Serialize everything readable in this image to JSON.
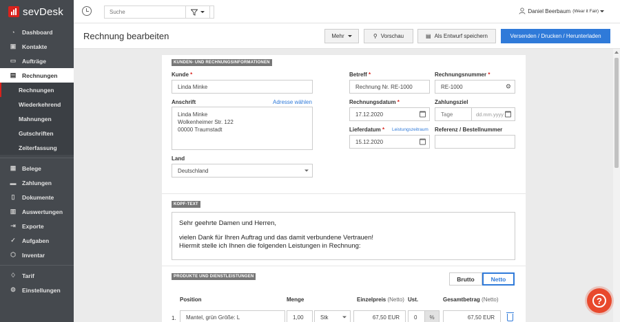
{
  "app": {
    "logo_text": "sevDesk"
  },
  "topbar": {
    "search_placeholder": "Suche",
    "user_name": "Daniel Beerbaum",
    "user_company": "(Wear it Fair)"
  },
  "sidebar": {
    "items": [
      {
        "label": "Dashboard",
        "icon": "speedometer-icon"
      },
      {
        "label": "Kontakte",
        "icon": "contacts-icon"
      },
      {
        "label": "Aufträge",
        "icon": "folder-icon"
      },
      {
        "label": "Rechnungen",
        "icon": "document-icon"
      }
    ],
    "sub_items": [
      {
        "label": "Rechnungen"
      },
      {
        "label": "Wiederkehrend"
      },
      {
        "label": "Mahnungen"
      },
      {
        "label": "Gutschriften"
      },
      {
        "label": "Zeiterfassung"
      }
    ],
    "items2": [
      {
        "label": "Belege",
        "icon": "receipt-icon"
      },
      {
        "label": "Zahlungen",
        "icon": "card-icon"
      },
      {
        "label": "Dokumente",
        "icon": "files-icon"
      },
      {
        "label": "Auswertungen",
        "icon": "chart-icon"
      },
      {
        "label": "Exporte",
        "icon": "export-icon"
      },
      {
        "label": "Aufgaben",
        "icon": "check-icon"
      },
      {
        "label": "Inventar",
        "icon": "box-icon"
      }
    ],
    "items3": [
      {
        "label": "Tarif",
        "icon": "bell-icon"
      },
      {
        "label": "Einstellungen",
        "icon": "gear-icon"
      }
    ]
  },
  "header": {
    "title": "Rechnung bearbeiten",
    "mehr": "Mehr",
    "vorschau": "Vorschau",
    "entwurf": "Als Entwurf speichern",
    "send": "Versenden / Drucken / Herunterladen"
  },
  "customer_section": {
    "tag": "KUNDEN- UND RECHNUNGSINFORMATIONEN",
    "kunde_label": "Kunde",
    "kunde_value": "Linda Minke",
    "anschrift_label": "Anschrift",
    "adresse_link": "Adresse wählen",
    "address_lines": [
      "Linda Minke",
      "Wolkenheimer Str. 122",
      "00000 Traumstadt"
    ],
    "land_label": "Land",
    "land_value": "Deutschland",
    "betreff_label": "Betreff",
    "betreff_value": "Rechnung Nr. RE-1000",
    "nummer_label": "Rechnungsnummer",
    "nummer_value": "RE-1000",
    "datum_label": "Rechnungsdatum",
    "datum_value": "17.12.2020",
    "ziel_label": "Zahlungsziel",
    "ziel_placeholder": "Tage",
    "ziel_date_placeholder": "dd.mm.yyyy",
    "liefer_label": "Lieferdatum",
    "leistung_link": "Leistungszeitraum",
    "liefer_value": "15.12.2020",
    "referenz_label": "Referenz / Bestellnummer",
    "referenz_value": ""
  },
  "kopf_section": {
    "tag": "KOPF-TEXT",
    "line1": "Sehr geehrte Damen und Herren,",
    "line2": "vielen Dank für Ihren Auftrag und das damit verbundene Vertrauen!",
    "line3": "Hiermit stelle ich Ihnen die folgenden Leistungen in Rechnung:"
  },
  "products_section": {
    "tag": "PRODUKTE UND DIENSTLEISTUNGEN",
    "brutto": "Brutto",
    "netto": "Netto",
    "col_position": "Position",
    "col_menge": "Menge",
    "col_einzelpreis": "Einzelpreis",
    "col_einzelpreis_note": "(Netto)",
    "col_ust": "Ust.",
    "col_gesamt": "Gesamtbetrag",
    "col_gesamt_note": "(Netto)",
    "rows": [
      {
        "num": "1.",
        "name": "Mantel, grün Größe: L",
        "menge": "1,00",
        "unit": "Stk",
        "einzelpreis": "67,50 EUR",
        "ust": "0",
        "pct": "%",
        "gesamt": "67,50 EUR"
      }
    ]
  },
  "help": {
    "label": "?"
  }
}
